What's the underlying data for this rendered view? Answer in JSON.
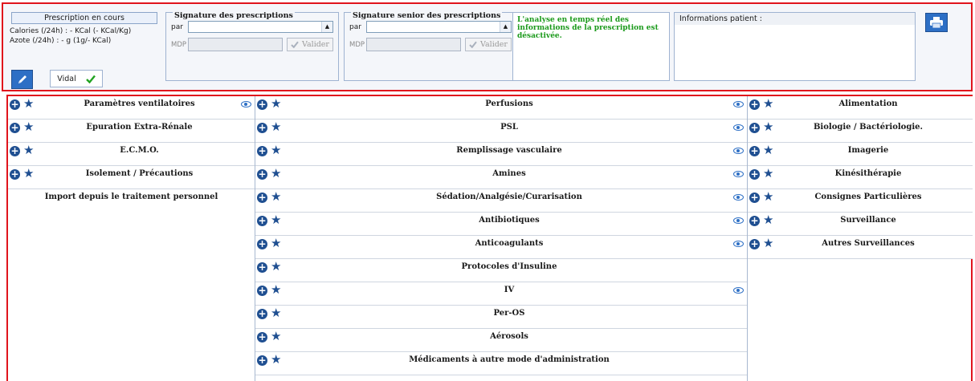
{
  "prescription": {
    "status_label": "Prescription en cours",
    "calories": "Calories (/24h) : - KCal (- KCal/Kg)",
    "azote": "Azote (/24h) : - g (1g/- KCal)",
    "vidal_label": "Vidal"
  },
  "signature": {
    "title": "Signature des prescriptions",
    "par_label": "par",
    "mdp_label": "MDP",
    "valider_label": "Valider"
  },
  "signature_senior": {
    "title": "Signature senior des prescriptions",
    "par_label": "par",
    "mdp_label": "MDP",
    "valider_label": "Valider"
  },
  "analysis": {
    "text": "L'analyse en temps réel des informations de la prescription est désactivée."
  },
  "patient": {
    "label": "Informations patient :"
  },
  "columns": {
    "left": [
      {
        "title": "Paramètres ventilatoires",
        "eye": true
      },
      {
        "title": "Epuration Extra-Rénale",
        "eye": false
      },
      {
        "title": "E.C.M.O.",
        "eye": false
      },
      {
        "title": "Isolement / Précautions",
        "eye": false
      }
    ],
    "left_import": "Import depuis le traitement personnel",
    "middle": [
      {
        "title": "Perfusions",
        "eye": true
      },
      {
        "title": "PSL",
        "eye": true
      },
      {
        "title": "Remplissage vasculaire",
        "eye": true
      },
      {
        "title": "Amines",
        "eye": true
      },
      {
        "title": "Sédation/Analgésie/Curarisation",
        "eye": true
      },
      {
        "title": "Antibiotiques",
        "eye": true
      },
      {
        "title": "Anticoagulants",
        "eye": true
      },
      {
        "title": "Protocoles d'Insuline",
        "eye": false
      },
      {
        "title": "IV",
        "eye": true
      },
      {
        "title": "Per-OS",
        "eye": false
      },
      {
        "title": "Aérosols",
        "eye": false
      },
      {
        "title": "Médicaments à autre mode d'administration",
        "eye": false
      }
    ],
    "right": [
      {
        "title": "Alimentation",
        "eye": false
      },
      {
        "title": "Biologie / Bactériologie.",
        "eye": false
      },
      {
        "title": "Imagerie",
        "eye": false
      },
      {
        "title": "Kinésithérapie",
        "eye": false
      },
      {
        "title": "Consignes Particulières",
        "eye": false
      },
      {
        "title": "Surveillance",
        "eye": false
      },
      {
        "title": "Autres Surveillances",
        "eye": false
      }
    ]
  },
  "colors": {
    "highlight_border": "#e0141c",
    "accent_blue": "#2d6fc5",
    "analysis_text": "#1b9a1b"
  }
}
